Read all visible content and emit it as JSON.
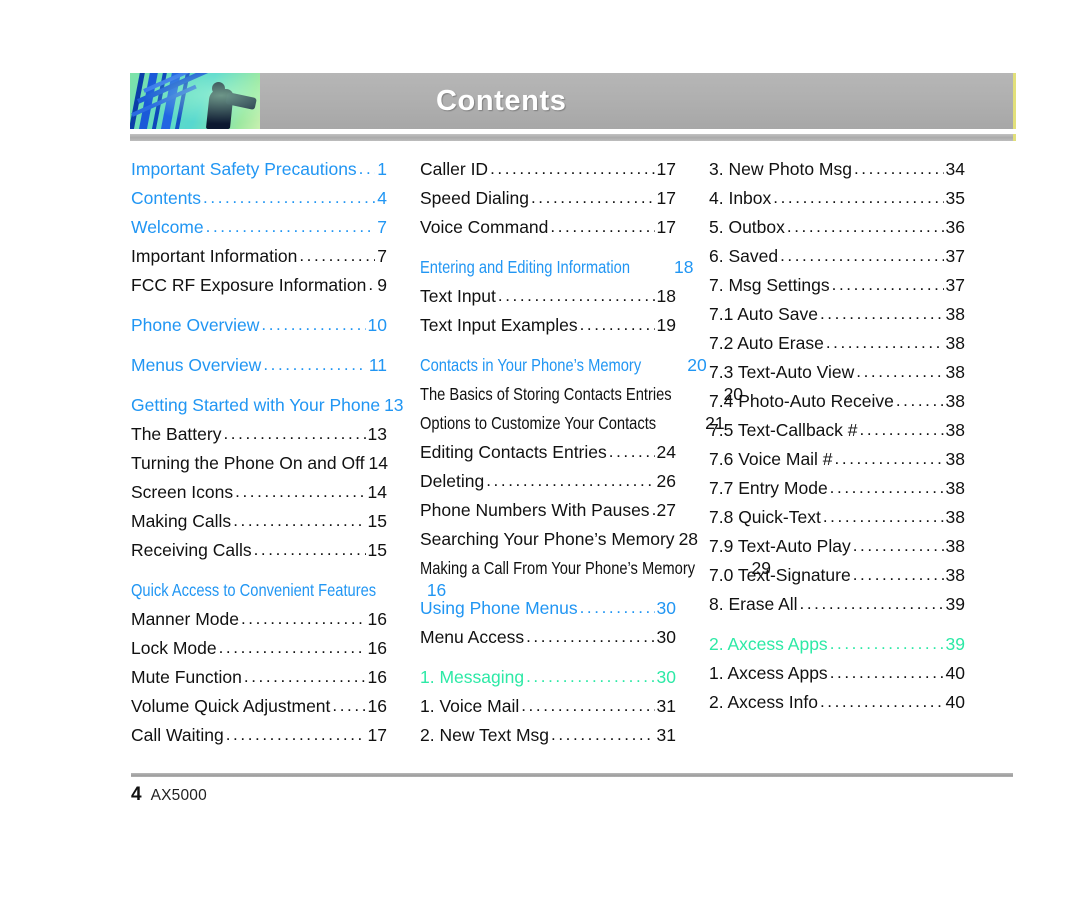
{
  "header": {
    "title": "Contents",
    "photo_alt": "abstract-blue-green-photo"
  },
  "colors": {
    "heading_blue": "#2196f3",
    "heading_green": "#2de9a6",
    "body_black": "#111111",
    "banner_gray": "#b0b0b0",
    "banner_edge_yellow": "#e2e07a"
  },
  "footer": {
    "page_number": "4",
    "model": "AX5000"
  },
  "columns": [
    {
      "id": "column-1",
      "entries": [
        {
          "label": "Important Safety Precautions",
          "page": "1",
          "style": "head"
        },
        {
          "label": "Contents",
          "page": "4",
          "style": "head"
        },
        {
          "label": "Welcome",
          "page": "7",
          "style": "head"
        },
        {
          "label": "Important Information",
          "page": "7",
          "style": "body"
        },
        {
          "label": "FCC RF Exposure Information",
          "page": "9",
          "style": "body"
        },
        {
          "label": "Phone Overview",
          "page": "10",
          "style": "head",
          "gap": true
        },
        {
          "label": "Menus Overview",
          "page": "11",
          "style": "head",
          "gap": true
        },
        {
          "label": "Getting Started with Your Phone",
          "page": "13",
          "style": "head",
          "gap": true
        },
        {
          "label": "The Battery",
          "page": "13",
          "style": "body"
        },
        {
          "label": "Turning the Phone On and Off",
          "page": "14",
          "style": "body"
        },
        {
          "label": "Screen Icons",
          "page": "14",
          "style": "body"
        },
        {
          "label": "Making Calls",
          "page": "15",
          "style": "body"
        },
        {
          "label": "Receiving Calls",
          "page": "15",
          "style": "body"
        },
        {
          "label": "Quick Access to Convenient Features",
          "page": "16",
          "style": "head",
          "gap": true,
          "condensed": true
        },
        {
          "label": "Manner Mode",
          "page": "16",
          "style": "body"
        },
        {
          "label": "Lock Mode",
          "page": "16",
          "style": "body"
        },
        {
          "label": "Mute Function",
          "page": "16",
          "style": "body"
        },
        {
          "label": "Volume Quick Adjustment",
          "page": "16",
          "style": "body"
        },
        {
          "label": "Call Waiting",
          "page": "17",
          "style": "body"
        }
      ]
    },
    {
      "id": "column-2",
      "entries": [
        {
          "label": "Caller ID",
          "page": "17",
          "style": "body"
        },
        {
          "label": "Speed Dialing",
          "page": "17",
          "style": "body"
        },
        {
          "label": "Voice Command",
          "page": "17",
          "style": "body"
        },
        {
          "label": "Entering and Editing Information",
          "page": "18",
          "style": "head",
          "gap": true,
          "condensed": true
        },
        {
          "label": "Text Input",
          "page": "18",
          "style": "body"
        },
        {
          "label": "Text Input Examples",
          "page": "19",
          "style": "body"
        },
        {
          "label": "Contacts in Your Phone’s Memory",
          "page": "20",
          "style": "head",
          "gap": true,
          "condensed": true
        },
        {
          "label": "The Basics of Storing Contacts Entries",
          "page": "20",
          "style": "body",
          "condensed": true
        },
        {
          "label": "Options to Customize Your Contacts",
          "page": "21",
          "style": "body",
          "condensed": true
        },
        {
          "label": "Editing Contacts Entries",
          "page": "24",
          "style": "body"
        },
        {
          "label": "Deleting",
          "page": "26",
          "style": "body"
        },
        {
          "label": "Phone Numbers With Pauses",
          "page": "27",
          "style": "body"
        },
        {
          "label": "Searching Your Phone’s Memory",
          "page": "28",
          "style": "body"
        },
        {
          "label": "Making a Call From Your Phone’s Memory",
          "page": "29",
          "style": "body",
          "condensed": true
        },
        {
          "label": "Using Phone Menus",
          "page": "30",
          "style": "head",
          "gap": true
        },
        {
          "label": "Menu Access",
          "page": "30",
          "style": "body"
        },
        {
          "label": "1. Messaging",
          "page": "30",
          "style": "head2",
          "gap": true
        },
        {
          "label": "1. Voice Mail",
          "page": "31",
          "style": "body"
        },
        {
          "label": "2. New Text Msg",
          "page": "31",
          "style": "body"
        }
      ]
    },
    {
      "id": "column-3",
      "entries": [
        {
          "label": "3. New Photo Msg",
          "page": "34",
          "style": "body"
        },
        {
          "label": "4. Inbox",
          "page": "35",
          "style": "body"
        },
        {
          "label": "5. Outbox",
          "page": "36",
          "style": "body"
        },
        {
          "label": "6. Saved",
          "page": "37",
          "style": "body"
        },
        {
          "label": "7. Msg Settings",
          "page": "37",
          "style": "body"
        },
        {
          "label": "7.1 Auto Save",
          "page": "38",
          "style": "body"
        },
        {
          "label": "7.2 Auto Erase",
          "page": "38",
          "style": "body"
        },
        {
          "label": "7.3 Text-Auto View",
          "page": "38",
          "style": "body"
        },
        {
          "label": "7.4 Photo-Auto Receive",
          "page": "38",
          "style": "body"
        },
        {
          "label": "7.5 Text-Callback #",
          "page": "38",
          "style": "body"
        },
        {
          "label": "7.6 Voice Mail #",
          "page": "38",
          "style": "body"
        },
        {
          "label": "7.7 Entry Mode",
          "page": "38",
          "style": "body"
        },
        {
          "label": "7.8 Quick-Text",
          "page": "38",
          "style": "body"
        },
        {
          "label": "7.9 Text-Auto Play",
          "page": "38",
          "style": "body"
        },
        {
          "label": "7.0 Text-Signature",
          "page": "38",
          "style": "body"
        },
        {
          "label": "8. Erase All",
          "page": "39",
          "style": "body"
        },
        {
          "label": "2. Axcess Apps",
          "page": "39",
          "style": "head2",
          "gap": true
        },
        {
          "label": "1. Axcess Apps",
          "page": "40",
          "style": "body"
        },
        {
          "label": "2. Axcess Info",
          "page": "40",
          "style": "body"
        }
      ]
    }
  ]
}
